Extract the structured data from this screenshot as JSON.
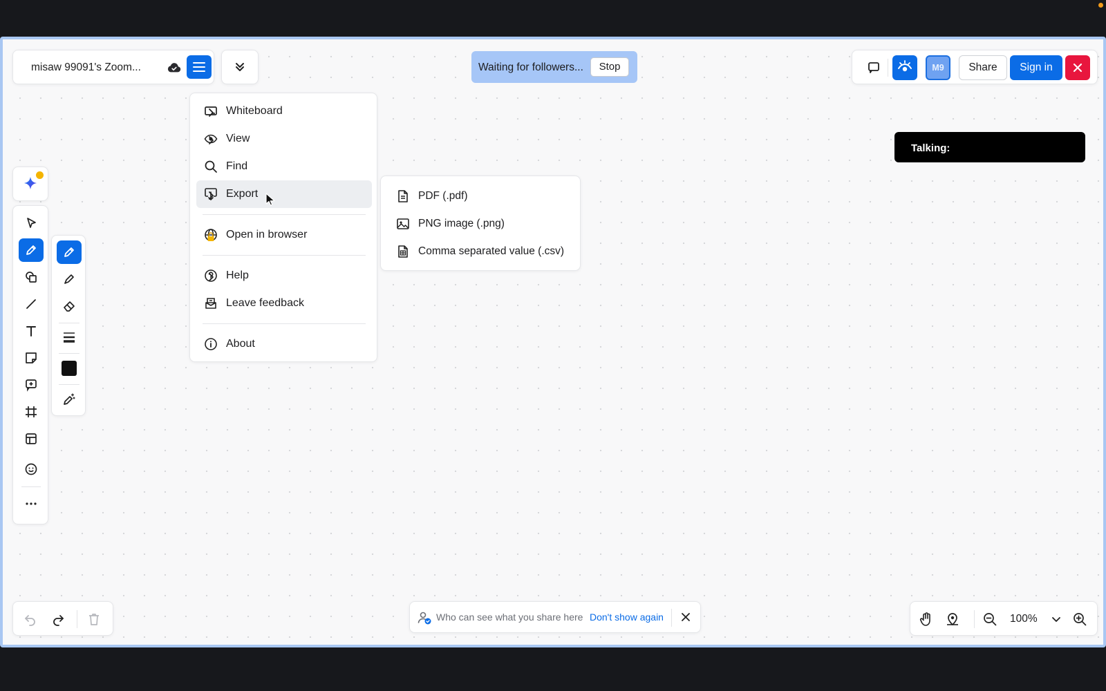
{
  "board": {
    "title": "misaw 99091's Zoom...",
    "icons": {
      "cloud": "cloud-check-icon",
      "menu": "hamburger-menu-icon",
      "collapse": "double-chevron-down-icon"
    }
  },
  "following": {
    "status_text": "Waiting for followers...",
    "stop_label": "Stop"
  },
  "header_right": {
    "avatar_initials": "M9",
    "share_label": "Share",
    "signin_label": "Sign in",
    "icons": {
      "chat": "comment-icon",
      "follow": "eye-follow-icon",
      "close": "close-icon"
    }
  },
  "talking": {
    "label": "Talking:"
  },
  "main_menu": {
    "items": [
      {
        "label": "Whiteboard",
        "icon": "whiteboard-icon",
        "submenu": true
      },
      {
        "label": "View",
        "icon": "eye-icon",
        "submenu": true
      },
      {
        "label": "Find",
        "icon": "search-icon",
        "submenu": false
      },
      {
        "label": "Export",
        "icon": "export-icon",
        "submenu": true,
        "highlighted": true
      },
      {
        "label": "Open in browser",
        "icon": "globe-icon",
        "submenu": false,
        "locked": true
      },
      {
        "label": "Help",
        "icon": "help-circle-icon",
        "submenu": true
      },
      {
        "label": "Leave feedback",
        "icon": "feedback-icon",
        "submenu": false
      },
      {
        "label": "About",
        "icon": "info-icon",
        "submenu": false
      }
    ]
  },
  "export_menu": {
    "items": [
      {
        "label": "PDF (.pdf)",
        "icon": "pdf-file-icon"
      },
      {
        "label": "PNG image (.png)",
        "icon": "image-icon"
      },
      {
        "label": "Comma separated value (.csv)",
        "icon": "csv-file-icon"
      }
    ]
  },
  "toolbar": {
    "tools": [
      "select-tool",
      "pen-tool",
      "shapes-tool",
      "line-tool",
      "text-tool",
      "sticky-note-tool",
      "comment-tool",
      "frame-tool",
      "template-tool",
      "emoji-tool",
      "more-tool"
    ],
    "active_tool": "pen-tool",
    "pen_options": [
      "pen",
      "highlighter",
      "eraser",
      "stroke-width",
      "color",
      "magic-pen"
    ],
    "active_pen_option": "pen",
    "selected_color": "#111111"
  },
  "notice": {
    "text": "Who can see what you share here",
    "link_label": "Don't show again"
  },
  "zoom": {
    "level": "100%"
  },
  "colors": {
    "accent": "#0b6ce6",
    "danger": "#e8163e",
    "banner": "#a6c6f7",
    "frame_border": "#a9c7f2"
  }
}
